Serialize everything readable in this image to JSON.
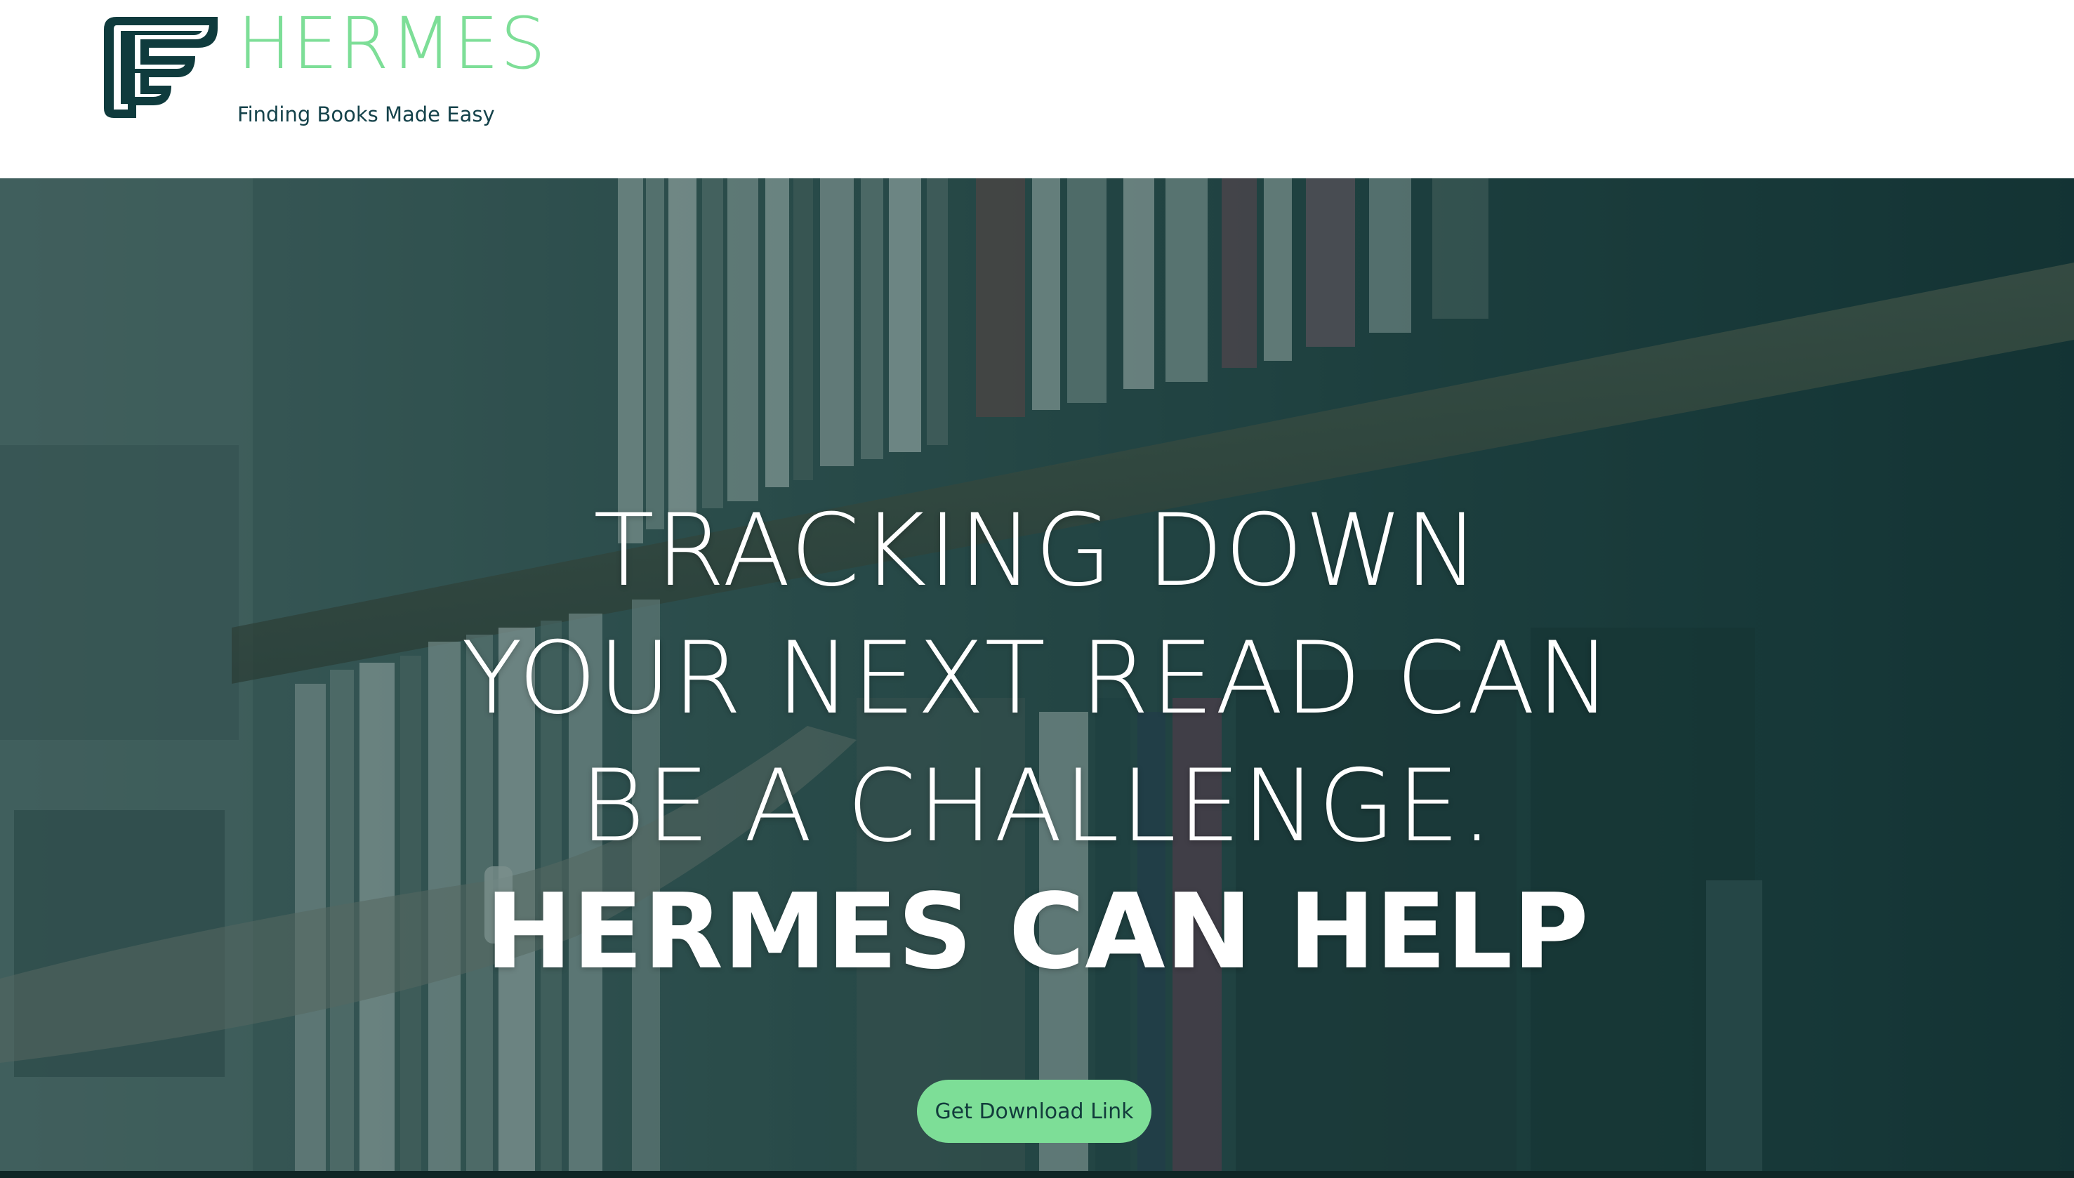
{
  "header": {
    "brand_name": "HERMES",
    "tagline": "Finding Books Made Easy",
    "logo_icon": "winged-f-logo-icon"
  },
  "hero": {
    "headline_lines": [
      "TRACKING DOWN",
      "YOUR NEXT READ CAN",
      "BE A CHALLENGE."
    ],
    "headline_strong": "HERMES CAN HELP",
    "cta_label": "Get Download Link",
    "background_image": "library-bookshelf-photo"
  },
  "colors": {
    "accent": "#7dde97",
    "brand_dark": "#0f3b3d",
    "overlay": "#133b3b",
    "text_light": "#ffffff"
  }
}
